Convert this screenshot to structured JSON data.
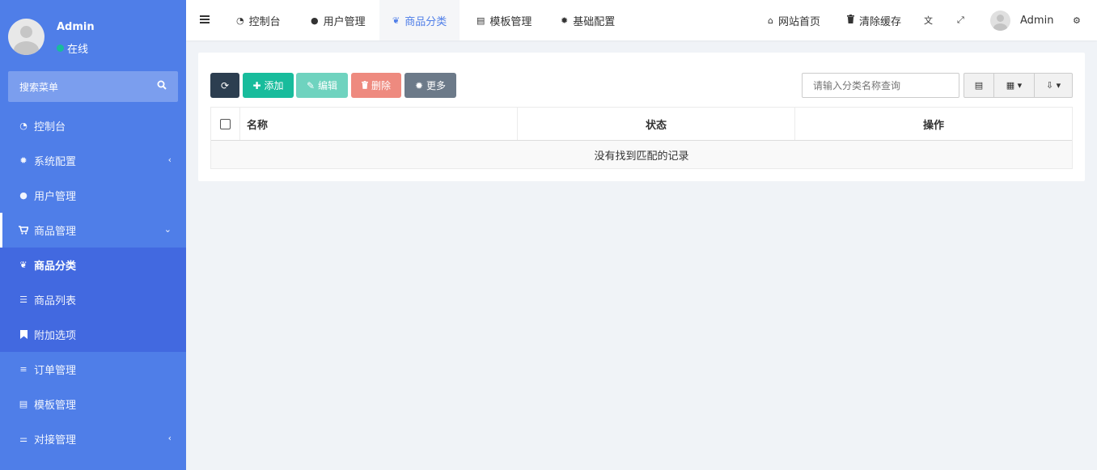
{
  "user": {
    "name": "Admin",
    "status": "在线"
  },
  "sidebar": {
    "search_placeholder": "搜索菜单",
    "items": [
      {
        "label": "控制台",
        "icon": "dashboard-icon"
      },
      {
        "label": "系统配置",
        "icon": "gear-icon"
      },
      {
        "label": "用户管理",
        "icon": "user-icon"
      },
      {
        "label": "商品管理",
        "icon": "cart-icon"
      },
      {
        "label": "商品分类",
        "icon": "leaf-icon"
      },
      {
        "label": "商品列表",
        "icon": "list-icon"
      },
      {
        "label": "附加选项",
        "icon": "bookmark-icon"
      },
      {
        "label": "订单管理",
        "icon": "bars-icon"
      },
      {
        "label": "模板管理",
        "icon": "list-alt-icon"
      },
      {
        "label": "对接管理",
        "icon": "sliders-icon"
      }
    ]
  },
  "topnav": {
    "tabs": [
      {
        "label": "控制台",
        "icon": "dashboard-icon"
      },
      {
        "label": "用户管理",
        "icon": "user-icon"
      },
      {
        "label": "商品分类",
        "icon": "leaf-icon"
      },
      {
        "label": "模板管理",
        "icon": "list-alt-icon"
      },
      {
        "label": "基础配置",
        "icon": "gear-icon"
      }
    ],
    "home": "网站首页",
    "clear_cache": "清除缓存",
    "admin": "Admin"
  },
  "toolbar": {
    "add": "添加",
    "edit": "编辑",
    "delete": "删除",
    "more": "更多",
    "search_placeholder": "请输入分类名称查询"
  },
  "table": {
    "columns": [
      "名称",
      "状态",
      "操作"
    ],
    "empty_text": "没有找到匹配的记录"
  },
  "colors": {
    "sidebar": "#4f7ee8",
    "submenu": "#4269e0",
    "success": "#18bc9c",
    "danger": "#ee8a7f",
    "dark": "#2c3e50",
    "accent": "#4f7ee8"
  }
}
